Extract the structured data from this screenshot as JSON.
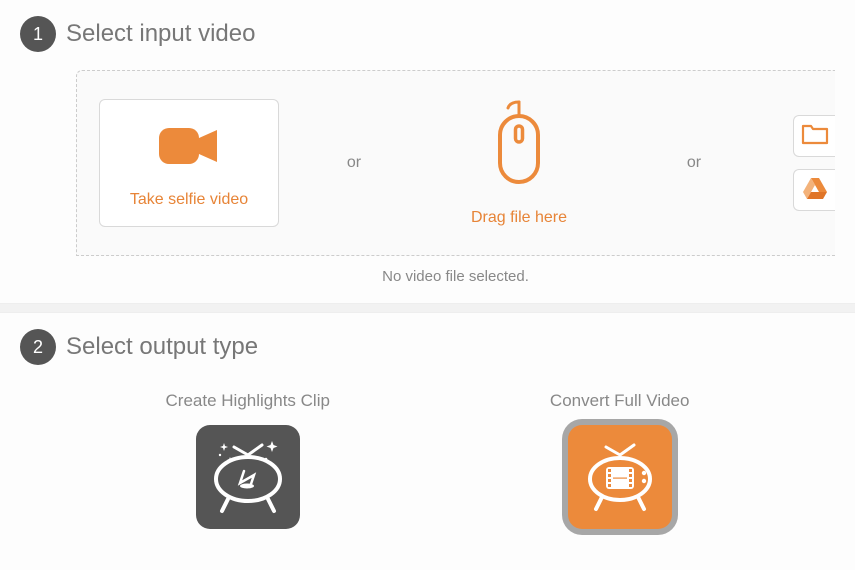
{
  "step1": {
    "number": "1",
    "title": "Select input video",
    "selfie_label": "Take selfie video",
    "or_text": "or",
    "drag_label": "Drag file here",
    "status": "No video file selected."
  },
  "step2": {
    "number": "2",
    "title": "Select output type",
    "highlights_label": "Create Highlights Clip",
    "convert_label": "Convert Full Video"
  },
  "colors": {
    "accent": "#e78437",
    "badge": "#555555"
  }
}
